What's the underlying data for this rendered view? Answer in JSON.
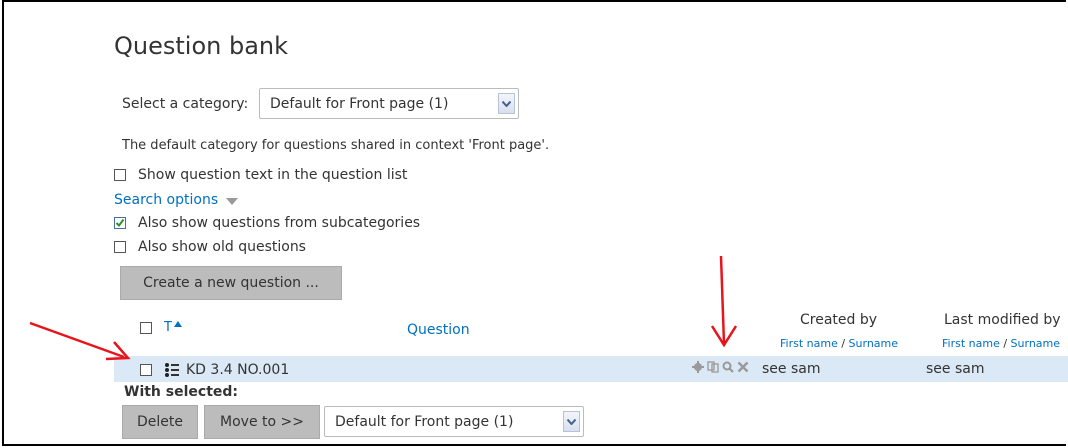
{
  "page": {
    "title": "Question bank",
    "category_label": "Select a category:",
    "category_value": "Default for Front page (1)",
    "description": "The default category for questions shared in context 'Front page'.",
    "show_question_text_label": "Show question text in the question list",
    "show_question_text_checked": false,
    "search_options_label": "Search options",
    "subcategories_label": "Also show questions from subcategories",
    "subcategories_checked": true,
    "old_questions_label": "Also show old questions",
    "old_questions_checked": false,
    "create_button": "Create a new question ..."
  },
  "table": {
    "col_type": "T",
    "col_question": "Question",
    "col_created_by": "Created by",
    "col_modified_by": "Last modified by",
    "sort_first": "First name",
    "sort_sep": " / ",
    "sort_last": "Surname",
    "rows": [
      {
        "name": "KD 3.4 NO.001",
        "created_by": "see sam",
        "modified_by": "see sam"
      }
    ]
  },
  "bulk": {
    "with_selected": "With selected:",
    "delete": "Delete",
    "move_to": "Move to >>",
    "target_category": "Default for Front page (1)"
  },
  "colors": {
    "link": "#0070c0",
    "row_highlight": "#dbe8f5",
    "annotation_arrow": "#e8141b",
    "button": "#bcbcbc"
  }
}
